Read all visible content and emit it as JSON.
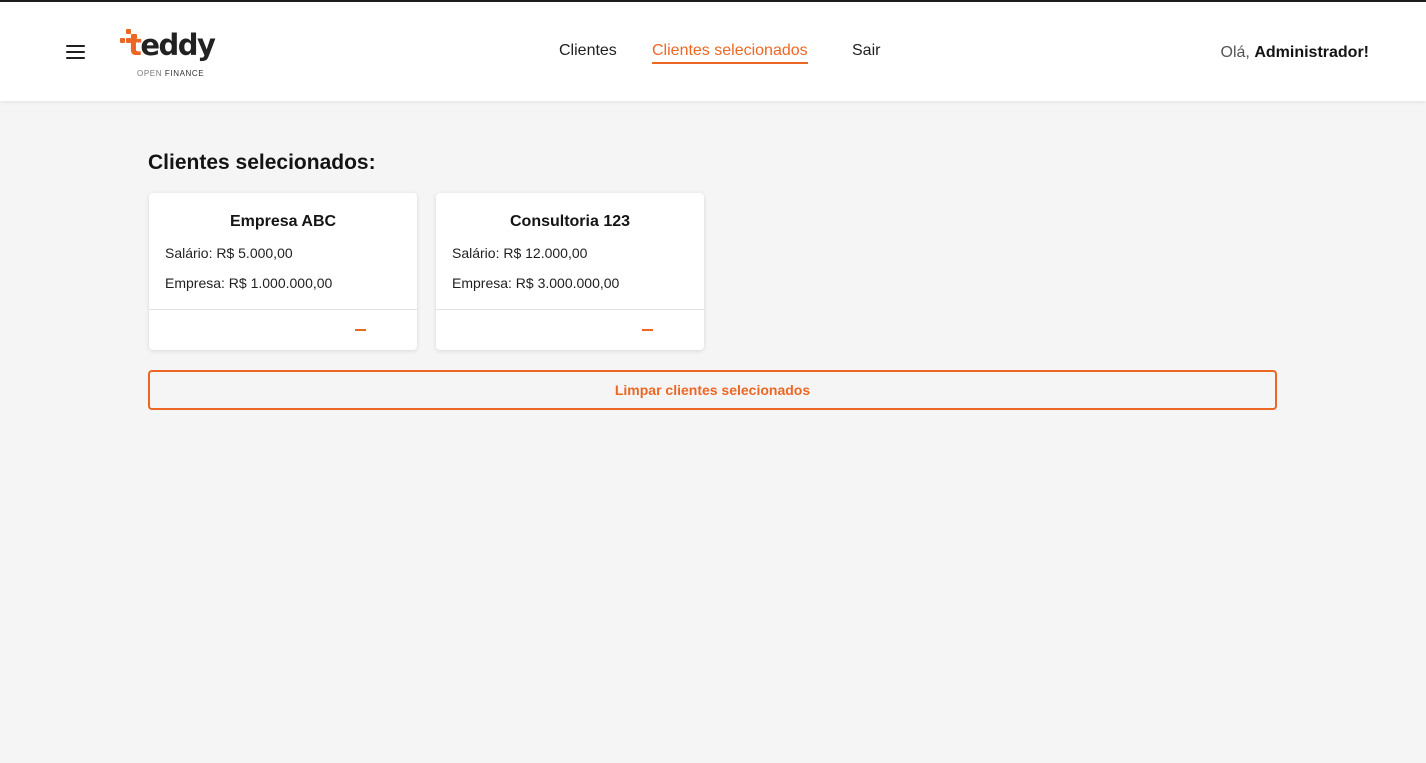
{
  "header": {
    "logo": {
      "word_prefix": "t",
      "word_rest": "eddy",
      "sub_light": "OPEN ",
      "sub_bold": "FINANCE"
    },
    "nav": [
      {
        "label": "Clientes",
        "active": false
      },
      {
        "label": "Clientes selecionados",
        "active": true
      },
      {
        "label": "Sair",
        "active": false
      }
    ],
    "greeting_prefix": "Olá, ",
    "greeting_name": "Administrador!"
  },
  "main": {
    "title": "Clientes selecionados:",
    "cards": [
      {
        "name": "Empresa ABC",
        "salary": "Salário: R$ 5.000,00",
        "company": "Empresa: R$ 1.000.000,00"
      },
      {
        "name": "Consultoria 123",
        "salary": "Salário: R$ 12.000,00",
        "company": "Empresa: R$ 3.000.000,00"
      }
    ],
    "clear_button": "Limpar clientes selecionados"
  },
  "icons": {
    "menu": "hamburger-menu-icon",
    "remove": "minus-icon"
  },
  "colors": {
    "accent": "#ec6724",
    "background": "#f5f5f5",
    "surface": "#ffffff",
    "text": "#141414"
  }
}
